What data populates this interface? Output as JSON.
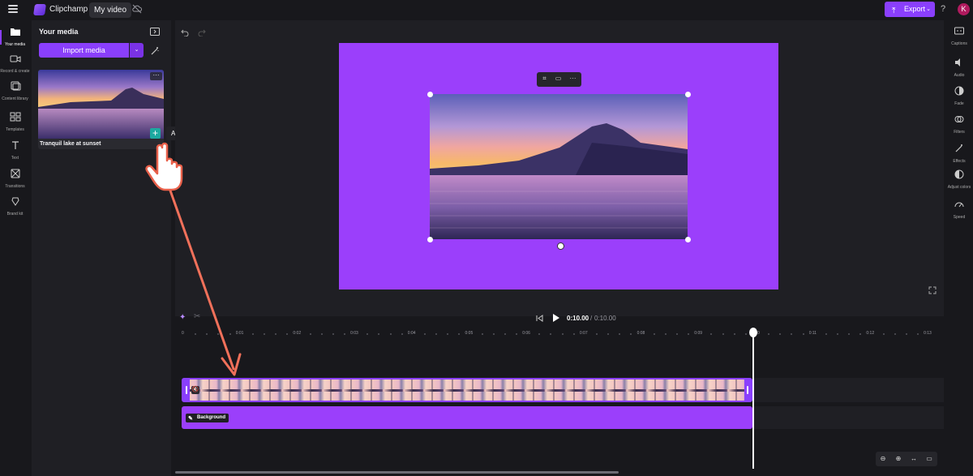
{
  "header": {
    "app_name": "Clipchamp",
    "project_title": "My video",
    "export_label": "Export",
    "help_label": "?",
    "avatar_initial": "K"
  },
  "left_rail": {
    "items": [
      {
        "label": "Your media",
        "icon": "folder-icon"
      },
      {
        "label": "Record & create",
        "icon": "camera-icon"
      },
      {
        "label": "Content library",
        "icon": "library-icon"
      },
      {
        "label": "Templates",
        "icon": "templates-icon"
      },
      {
        "label": "Text",
        "icon": "text-icon"
      },
      {
        "label": "Transitions",
        "icon": "transitions-icon"
      },
      {
        "label": "Brand kit",
        "icon": "brand-kit-icon"
      }
    ]
  },
  "media_panel": {
    "title": "Your media",
    "import_label": "Import media",
    "item_caption": "Tranquil lake at sunset",
    "more_label": "···",
    "add_tooltip": "Add to timeline",
    "add_label": "+"
  },
  "preview_toolbar": {
    "crop": "⌗",
    "fit": "▭",
    "more": "···"
  },
  "playback": {
    "current_time": "0:10.00",
    "separator": "/",
    "duration": "0:10.00"
  },
  "ruler": {
    "labels": [
      "0",
      "0:01",
      "0:02",
      "0:03",
      "0:04",
      "0:05",
      "0:06",
      "0:07",
      "0:08",
      "0:09",
      "0:10",
      "0:11",
      "0:12",
      "0:13"
    ]
  },
  "timeline": {
    "background_label": "Background"
  },
  "right_rail": {
    "items": [
      {
        "label": "Captions",
        "icon": "captions-icon"
      },
      {
        "label": "Audio",
        "icon": "audio-icon"
      },
      {
        "label": "Fade",
        "icon": "fade-icon"
      },
      {
        "label": "Filters",
        "icon": "filters-icon"
      },
      {
        "label": "Effects",
        "icon": "effects-icon"
      },
      {
        "label": "Adjust colors",
        "icon": "adjust-colors-icon"
      },
      {
        "label": "Speed",
        "icon": "speed-icon"
      }
    ]
  },
  "colors": {
    "accent": "#8a3ffc",
    "canvas_bg": "#9b3ffb",
    "annotation_arrow": "#f0705a",
    "add_button": "#1ca9a0"
  }
}
